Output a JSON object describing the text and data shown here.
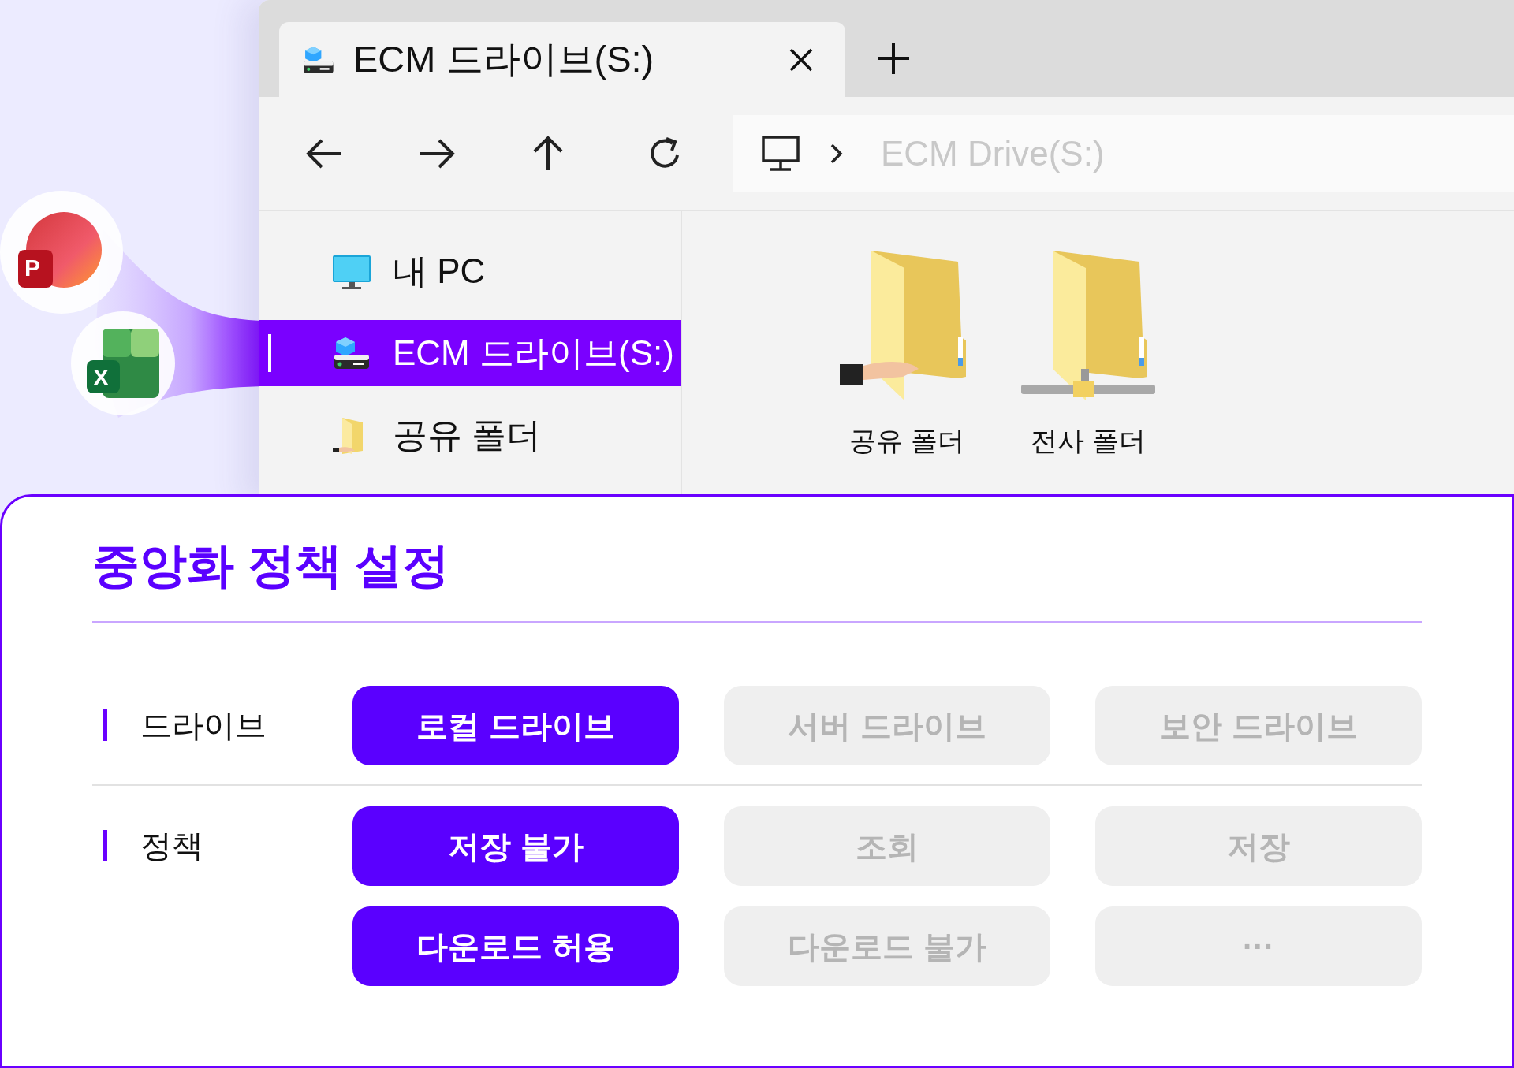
{
  "apps": [
    {
      "kind": "slides",
      "letter": "P"
    },
    {
      "kind": "sheet",
      "letter": "X"
    }
  ],
  "window": {
    "tabs": [
      {
        "title": "ECM 드라이브(S:)",
        "selected": true
      }
    ],
    "address": {
      "path": "ECM Drive(S:)"
    },
    "sidebar": {
      "items": [
        {
          "label": "내 PC",
          "kind": "pc",
          "selected": false
        },
        {
          "label": "ECM 드라이브(S:)",
          "kind": "drive",
          "selected": true
        },
        {
          "label": "공유 폴더",
          "kind": "shared",
          "selected": false
        }
      ]
    },
    "content": {
      "items": [
        {
          "label": "공유 폴더",
          "kind": "shared"
        },
        {
          "label": "전사 폴더",
          "kind": "network"
        }
      ]
    }
  },
  "policy": {
    "title": "중앙화 정책 설정",
    "groups": [
      {
        "label": "드라이브",
        "rows": [
          [
            {
              "label": "로컬 드라이브",
              "selected": true
            },
            {
              "label": "서버 드라이브",
              "selected": false
            },
            {
              "label": "보안 드라이브",
              "selected": false
            }
          ]
        ]
      },
      {
        "label": "정책",
        "rows": [
          [
            {
              "label": "저장 불가",
              "selected": true
            },
            {
              "label": "조회",
              "selected": false
            },
            {
              "label": "저장",
              "selected": false
            }
          ],
          [
            {
              "label": "다운로드 허용",
              "selected": true
            },
            {
              "label": "다운로드 불가",
              "selected": false
            },
            {
              "label": "···",
              "selected": false
            }
          ]
        ]
      }
    ]
  }
}
